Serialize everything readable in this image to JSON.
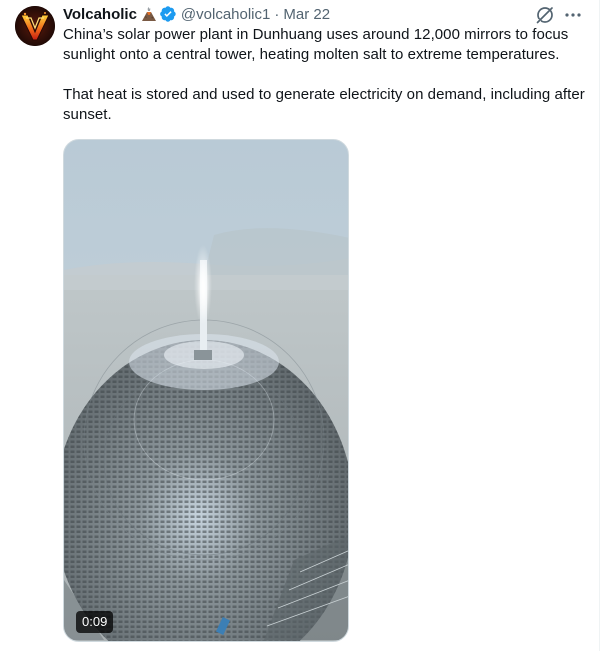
{
  "tweet": {
    "author": {
      "display_name": "Volcaholic",
      "badge_emoji_icon": "volcano-icon",
      "verified_icon": "verified-badge-icon",
      "handle": "@volcaholic1",
      "separator": "·",
      "date": "Mar 22",
      "avatar_icon": "volcaholic-logo-avatar"
    },
    "actions": {
      "grok_icon": "grok-icon",
      "more_icon": "more-icon"
    },
    "text": {
      "paragraph_1": "China’s solar power plant in Dunhuang uses around 12,000 mirrors to focus sunlight onto a central tower, heating molten salt to extreme temperatures.",
      "paragraph_2": "That heat is stored and used to generate electricity on demand, including after sunset."
    },
    "media": {
      "type": "video",
      "duration": "0:09"
    },
    "colors": {
      "verified": "#1d9bf0",
      "secondary_text": "#536471",
      "primary_text": "#0f1419"
    }
  }
}
